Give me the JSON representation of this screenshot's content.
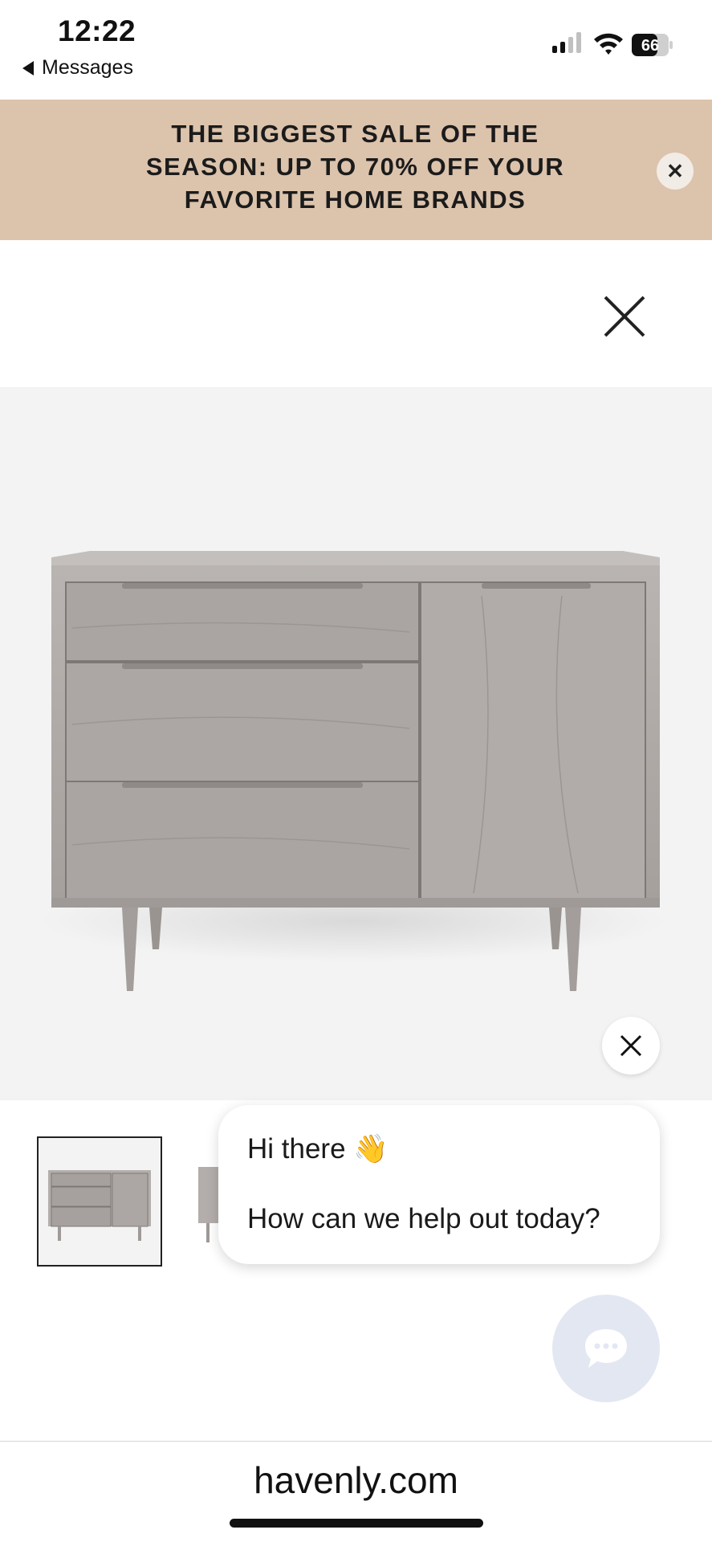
{
  "status_bar": {
    "time": "12:22",
    "back_label": "Messages",
    "battery": "66",
    "icons": [
      "cellular-signal-icon",
      "wifi-icon",
      "battery-icon"
    ]
  },
  "banner": {
    "text": "THE BIGGEST SALE OF THE SEASON: UP TO 70% OFF YOUR FAVORITE HOME BRANDS",
    "close_icon": "close-icon",
    "background": "#dcc3ac"
  },
  "product": {
    "image": "gray-wood-dresser",
    "close_icon": "close-icon"
  },
  "chat": {
    "greeting": "Hi there 👋",
    "prompt": "How can we help out today?",
    "launcher_icon": "chat-bubble-icon",
    "launcher_color": "#e3e7f2"
  },
  "browser": {
    "url": "havenly.com"
  }
}
